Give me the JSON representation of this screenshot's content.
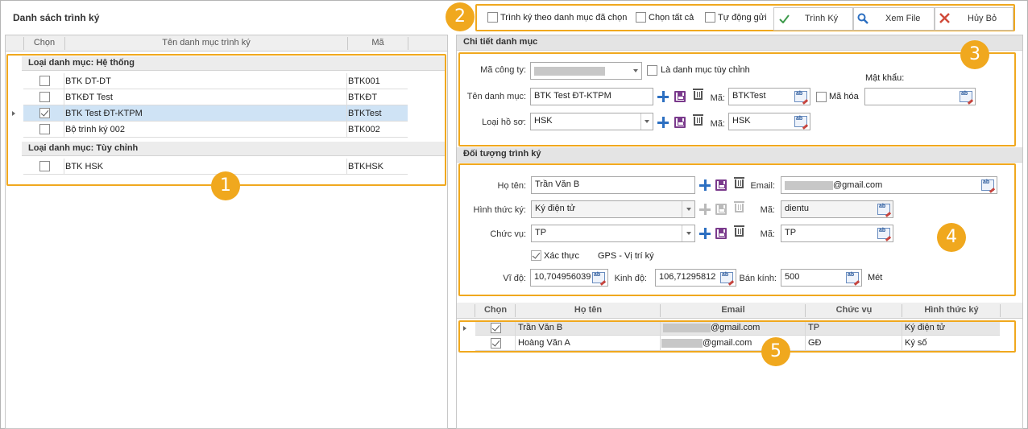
{
  "left": {
    "title": "Danh sách trình ký",
    "grid": {
      "headers": [
        "Chọn",
        "Tên danh mục trình ký",
        "Mã"
      ],
      "groups": [
        {
          "label": "Loại danh mục: Hệ thống",
          "rows": [
            {
              "checked": false,
              "name": "BTK DT-DT",
              "code": "BTK001"
            },
            {
              "checked": false,
              "name": "BTKĐT Test",
              "code": "BTKĐT"
            },
            {
              "checked": true,
              "name": "BTK Test ĐT-KTPM",
              "code": "BTKTest"
            },
            {
              "checked": false,
              "name": "Bộ trình ký 002",
              "code": "BTK002"
            }
          ]
        },
        {
          "label": "Loại danh mục: Tùy chỉnh",
          "rows": [
            {
              "checked": false,
              "name": "BTK HSK",
              "code": "BTKHSK"
            }
          ]
        }
      ]
    }
  },
  "toolbar": {
    "chk_by_list": "Trình ký theo danh mục đã chọn",
    "chk_all": "Chọn tất cả",
    "chk_auto": "Tự động gửi",
    "btn_sign": "Trình Ký",
    "btn_view": "Xem File",
    "btn_cancel": "Hủy Bỏ"
  },
  "detail": {
    "title": "Chi tiết danh mục",
    "company_label": "Mã công ty:",
    "custom_label": "Là danh mục tùy chỉnh",
    "password_label": "Mật khẩu:",
    "name_label": "Tên danh mục:",
    "name_value": "BTK Test ĐT-KTPM",
    "code_label": "Mã:",
    "code_value": "BTKTest",
    "encrypt_label": "Mã hóa",
    "type_label": "Loại hồ sơ:",
    "type_value": "HSK",
    "type_code_label": "Mã:",
    "type_code_value": "HSK"
  },
  "subject": {
    "title": "Đối tượng trình ký",
    "name_label": "Họ tên:",
    "name_value": "Trần Văn B",
    "email_label": "Email:",
    "email_value": "@gmail.com",
    "method_label": "Hình thức ký:",
    "method_value": "Ký điện tử",
    "method_code_label": "Mã:",
    "method_code_value": "dientu",
    "position_label": "Chức vụ:",
    "position_value": "TP",
    "position_code_label": "Mã:",
    "position_code_value": "TP",
    "verify_label": "Xác thực",
    "gps_label": "GPS - Vị trí ký",
    "lat_label": "Vĩ độ:",
    "lat_value": "10,704956039",
    "lng_label": "Kinh độ:",
    "lng_value": "106,71295812",
    "radius_label": "Bán kính:",
    "radius_value": "500",
    "unit_label": "Mét"
  },
  "signers": {
    "headers": [
      "Chọn",
      "Họ tên",
      "Email",
      "Chức vụ",
      "Hình thức ký"
    ],
    "rows": [
      {
        "checked": true,
        "name": "Trần Văn B",
        "email": "@gmail.com",
        "position": "TP",
        "method": "Ký điện tử"
      },
      {
        "checked": true,
        "name": "Hoàng Văn A",
        "email": "@gmail.com",
        "position": "GĐ",
        "method": "Ký số"
      }
    ]
  },
  "badges": [
    "1",
    "2",
    "3",
    "4",
    "5"
  ],
  "colors": {
    "highlight": "#f0a81e",
    "selected_row": "#cfe3f5",
    "accent_blue": "#2c6fc1"
  }
}
